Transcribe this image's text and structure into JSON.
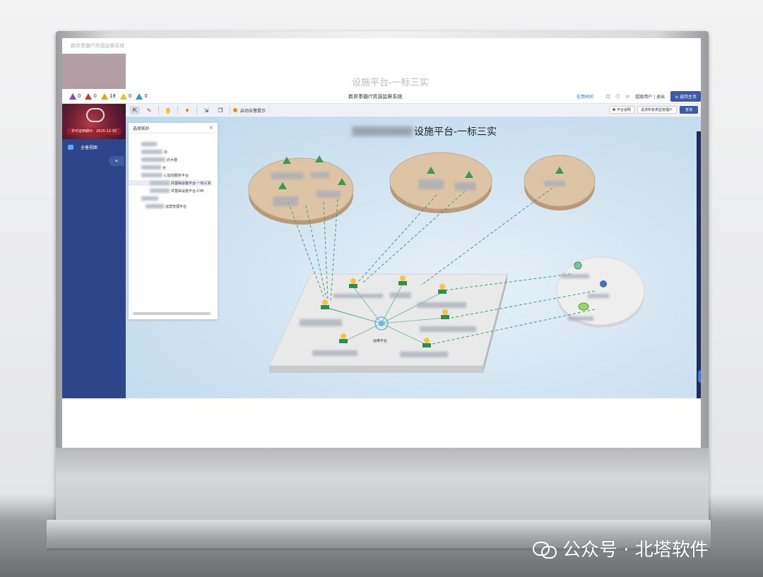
{
  "alerts": [
    {
      "count": "0",
      "color": "#8e44ad"
    },
    {
      "count": "0",
      "color": "#d0312d"
    },
    {
      "count": "18",
      "color": "#f39c12"
    },
    {
      "count": "0",
      "color": "#e6c229"
    },
    {
      "count": "0",
      "color": "#3b8fd9"
    }
  ],
  "header": {
    "app_title": "数昇季霸IT资源监察系统",
    "user_online": "在用时间",
    "user_name": "超级用户 | 退出",
    "exit_label": "≡ 返回主页"
  },
  "sidebar": {
    "banner_date": "许可证到期日：2025-12-30",
    "items": [
      {
        "label": "全备视图",
        "icon": "monitor-icon"
      }
    ],
    "collapse_label": "«"
  },
  "toolbar": {
    "items": [
      "select-icon",
      "edit-icon",
      "hand-icon",
      "bell-icon",
      "export-icon",
      "copy-icon"
    ],
    "active_label": "启动告警提示",
    "help_label": "❷ 平台说明",
    "category_placeholder": "请求所有类型管理户",
    "query_label": "查询"
  },
  "map": {
    "title_suffix": "设施平台-一标三实",
    "center_label": "运维平台"
  },
  "tree_panel": {
    "title": "选择拓扑",
    "close_label": "×",
    "rows": [
      {
        "indent": 18,
        "text": ""
      },
      {
        "indent": 18,
        "text": "办"
      },
      {
        "indent": 18,
        "text": "办大楼"
      },
      {
        "indent": 18,
        "text": "台"
      },
      {
        "indent": 18,
        "text": "心监控服务平台"
      },
      {
        "indent": 30,
        "text": "共基础设施平台-一标三实"
      },
      {
        "indent": 30,
        "text": "共基础设施平台-CIM"
      },
      {
        "indent": 18,
        "text": ""
      },
      {
        "indent": 24,
        "text": "运营管理平台"
      }
    ]
  },
  "watermark": {
    "text": "公众号 · 北塔软件"
  }
}
